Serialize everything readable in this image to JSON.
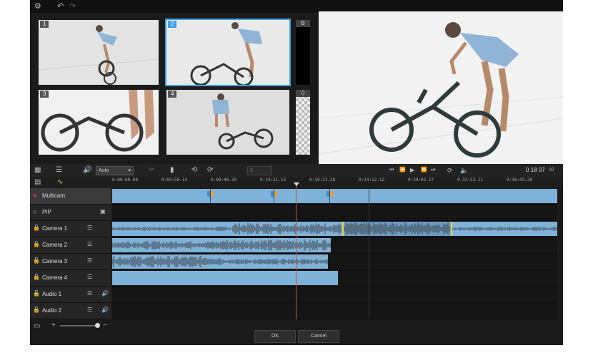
{
  "camera_labels": [
    "1",
    "2",
    "3",
    "4"
  ],
  "side_labels": [
    "B",
    "0"
  ],
  "controls": {
    "mode_value": "Auto",
    "number_value": "3",
    "timecode": "0 18 07",
    "timecode_suffix": "07"
  },
  "ruler": {
    "ticks": [
      "0:00:00.00",
      "0:04:50.14",
      "0:09:40.29",
      "0:14:31.13",
      "0:19:21.28",
      "0:24:12.12",
      "0:29:02.27",
      "0:33:53.11",
      "0:38:43.26"
    ]
  },
  "tracks": [
    {
      "name": "Multicam"
    },
    {
      "name": "PIP"
    },
    {
      "name": "Camera 1"
    },
    {
      "name": "Camera 2"
    },
    {
      "name": "Camera 3"
    },
    {
      "name": "Camera 4"
    },
    {
      "name": "Audio 1"
    },
    {
      "name": "Audio 2"
    }
  ],
  "footer": {
    "ok_label": "OK",
    "cancel_label": "Cancel"
  },
  "colors": {
    "clip": "#7fb2d8",
    "accent": "#3ea1e6",
    "playhead": "#c2553a",
    "record": "#e03030"
  }
}
